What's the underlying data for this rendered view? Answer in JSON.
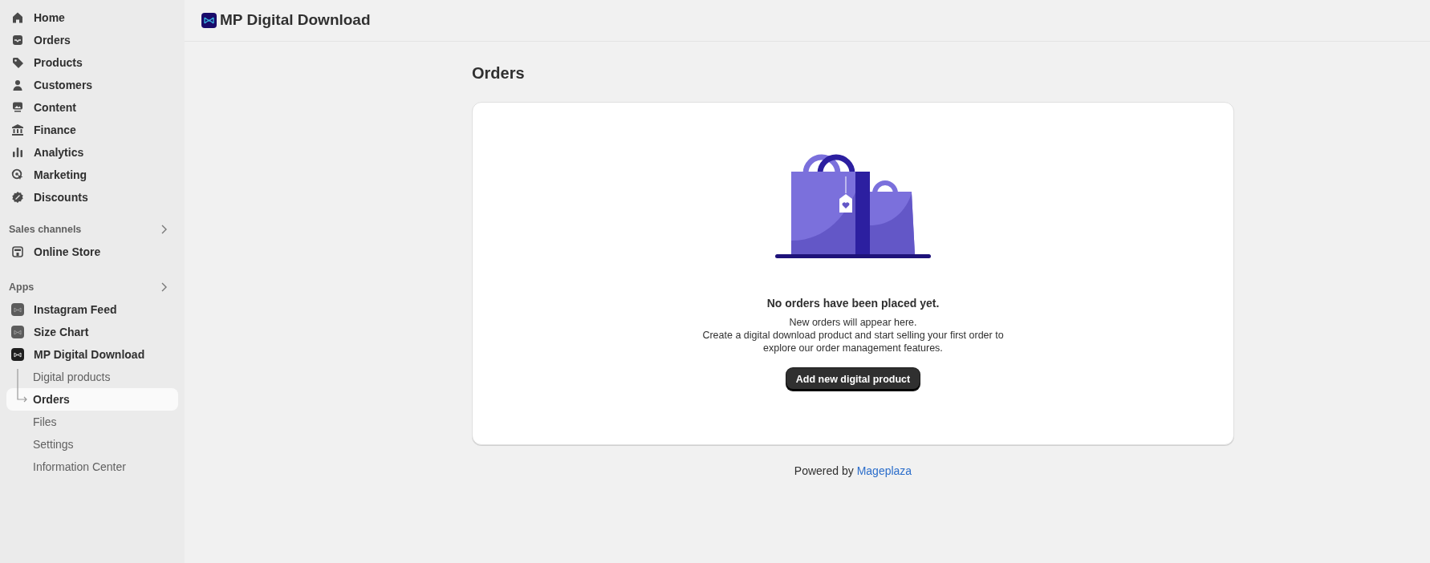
{
  "sidebar": {
    "nav": [
      {
        "label": "Home"
      },
      {
        "label": "Orders"
      },
      {
        "label": "Products"
      },
      {
        "label": "Customers"
      },
      {
        "label": "Content"
      },
      {
        "label": "Finance"
      },
      {
        "label": "Analytics"
      },
      {
        "label": "Marketing"
      },
      {
        "label": "Discounts"
      }
    ],
    "sales_channels": {
      "title": "Sales channels",
      "items": [
        {
          "label": "Online Store"
        }
      ]
    },
    "apps": {
      "title": "Apps",
      "items": [
        {
          "label": "Instagram Feed",
          "expanded": false
        },
        {
          "label": "Size Chart",
          "expanded": false
        },
        {
          "label": "MP Digital Download",
          "expanded": true,
          "children": [
            {
              "label": "Digital products",
              "selected": false
            },
            {
              "label": "Orders",
              "selected": true
            },
            {
              "label": "Files",
              "selected": false
            },
            {
              "label": "Settings",
              "selected": false
            },
            {
              "label": "Information Center",
              "selected": false
            }
          ]
        }
      ]
    }
  },
  "header": {
    "title": "MP Digital Download"
  },
  "page": {
    "title": "Orders",
    "empty_state": {
      "heading": "No orders have been placed yet.",
      "lines": [
        "New orders will appear here.",
        "Create a digital download product and start selling your first order to",
        "explore our order management features."
      ],
      "button": "Add new digital product"
    },
    "footer": {
      "text": "Powered by",
      "link": "Mageplaza"
    }
  }
}
